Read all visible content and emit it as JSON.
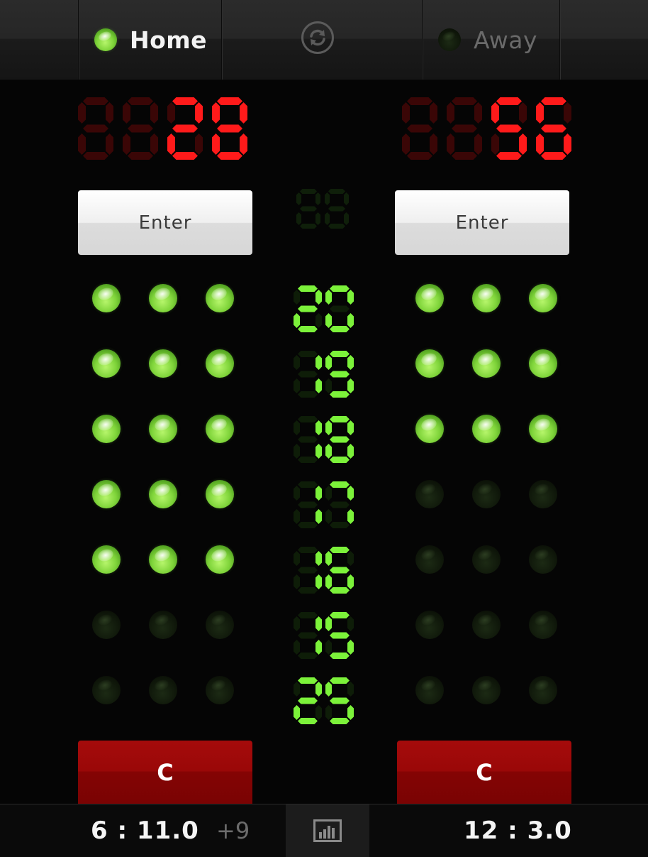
{
  "topbar": {
    "home": {
      "label": "Home",
      "active": true
    },
    "away": {
      "label": "Away",
      "active": false
    },
    "swap_icon": "refresh-icon"
  },
  "scores": {
    "home": {
      "digits": "0128",
      "lit_from": 2
    },
    "away": {
      "digits": "0056",
      "lit_from": 2
    },
    "center": {
      "digits": "88",
      "lit_from": 2
    },
    "color_on": "#ff1a1a",
    "color_off": "#3a0606"
  },
  "enter_buttons": {
    "home_label": "Enter",
    "away_label": "Enter"
  },
  "targets": {
    "color_on": "#7cf23a",
    "color_off": "#0e1d08",
    "rows": [
      {
        "digits": "20",
        "lit_from": 0,
        "home": [
          1,
          1,
          1
        ],
        "away": [
          1,
          1,
          1
        ]
      },
      {
        "digits": "19",
        "lit_from": 0,
        "home": [
          1,
          1,
          1
        ],
        "away": [
          1,
          1,
          1
        ]
      },
      {
        "digits": "18",
        "lit_from": 0,
        "home": [
          1,
          1,
          1
        ],
        "away": [
          1,
          1,
          1
        ]
      },
      {
        "digits": "17",
        "lit_from": 0,
        "home": [
          1,
          1,
          1
        ],
        "away": [
          0,
          0,
          0
        ]
      },
      {
        "digits": "16",
        "lit_from": 0,
        "home": [
          1,
          1,
          1
        ],
        "away": [
          0,
          0,
          0
        ]
      },
      {
        "digits": "15",
        "lit_from": 0,
        "home": [
          0,
          0,
          0
        ],
        "away": [
          0,
          0,
          0
        ]
      },
      {
        "digits": "25",
        "lit_from": 0,
        "home": [
          0,
          0,
          0
        ],
        "away": [
          0,
          0,
          0
        ]
      }
    ]
  },
  "clear_buttons": {
    "home_label": "C",
    "away_label": "C"
  },
  "bottombar": {
    "home_clock": "6 : 11.0",
    "home_bonus": "+9",
    "away_clock": "12 : 3.0",
    "stats_icon": "bar-chart-icon"
  }
}
